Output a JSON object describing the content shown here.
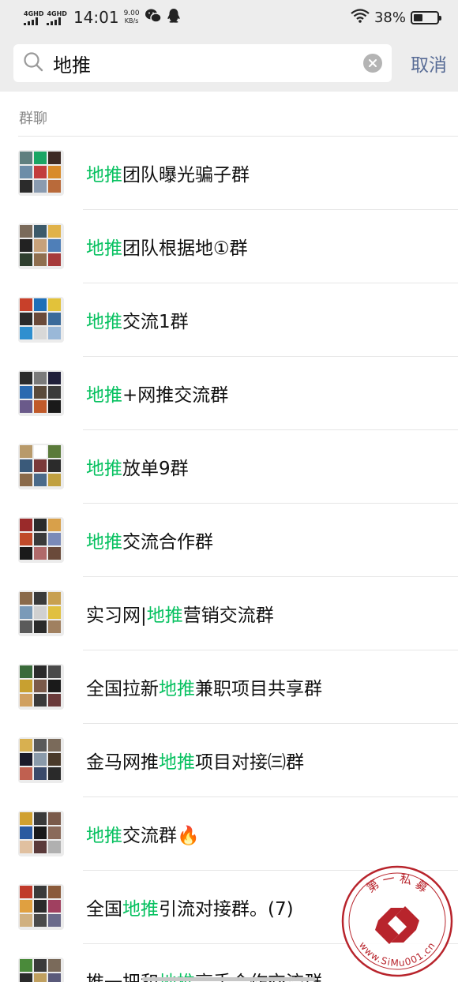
{
  "status_bar": {
    "net1": "4GHD",
    "net2": "4GHD",
    "time": "14:01",
    "speed_value": "9.00",
    "speed_unit": "KB/s",
    "battery_percent": "38%",
    "battery_level": 0.38,
    "icons": [
      "signal-icon",
      "wechat-icon",
      "qq-icon",
      "wifi-icon",
      "battery-icon"
    ]
  },
  "search": {
    "query": "地推",
    "cancel_label": "取消"
  },
  "section": {
    "label": "群聊"
  },
  "results": [
    {
      "before": "",
      "highlight": "地推",
      "after": "团队曝光骗子群",
      "colors": [
        "#5f7f7f",
        "#1aa564",
        "#3d2a24",
        "#6c8da8",
        "#c23d3d",
        "#d88b2a",
        "#2b2b2b",
        "#8a9bb0",
        "#b96a3a"
      ]
    },
    {
      "before": "",
      "highlight": "地推",
      "after": "团队根据地①群",
      "colors": [
        "#7a6a5a",
        "#3c5a6a",
        "#e0b24a",
        "#222222",
        "#c7a17a",
        "#4f7fb8",
        "#2f3f2f",
        "#8f6f4f",
        "#a63a3a"
      ]
    },
    {
      "before": "",
      "highlight": "地推",
      "after": "交流1群",
      "colors": [
        "#c8402a",
        "#1f6fb8",
        "#e2c23a",
        "#2b2b2b",
        "#6a4a3a",
        "#3a6a9a",
        "#2f8fcf",
        "#d8d8d8",
        "#9ab8d8"
      ]
    },
    {
      "before": "",
      "highlight": "地推",
      "after": "+网推交流群",
      "colors": [
        "#2b2b2b",
        "#7a7a7a",
        "#1f1f3a",
        "#2a6ab0",
        "#5a4a3a",
        "#3a3a3a",
        "#6a5a8a",
        "#c05a2a",
        "#1a1a1a"
      ]
    },
    {
      "before": "",
      "highlight": "地推",
      "after": "放单9群",
      "colors": [
        "#b89a6a",
        "#ffffff",
        "#5a7a3a",
        "#3a5a7a",
        "#7a3a3a",
        "#2b2b2b",
        "#8a6a4a",
        "#4a6a8a",
        "#c0a040"
      ]
    },
    {
      "before": "",
      "highlight": "地推",
      "after": "交流合作群",
      "colors": [
        "#9a2a2a",
        "#2b2b2b",
        "#d8a04a",
        "#c04a2a",
        "#3a3a3a",
        "#7a8ab8",
        "#1a1a1a",
        "#b06a6a",
        "#6a4a3a"
      ]
    },
    {
      "before": "实习网|",
      "highlight": "地推",
      "after": "营销交流群",
      "colors": [
        "#8a6a4a",
        "#3a3a3a",
        "#c8a050",
        "#7a9ab8",
        "#d0d0d0",
        "#e0c040",
        "#5a5a5a",
        "#2b2b2b",
        "#a08060"
      ]
    },
    {
      "before": "全国拉新",
      "highlight": "地推",
      "after": "兼职项目共享群",
      "colors": [
        "#3a6a3a",
        "#2b2b2b",
        "#4a4a4a",
        "#c8a030",
        "#7a5a4a",
        "#1a1a1a",
        "#d0a060",
        "#3a3a3a",
        "#6a3a3a"
      ]
    },
    {
      "before": "金马网推",
      "highlight": "地推",
      "after": "项目对接㈢群",
      "colors": [
        "#d8b050",
        "#5a5a5a",
        "#7a6a5a",
        "#1a1a2a",
        "#8a9aaa",
        "#4a3a2a",
        "#c06050",
        "#3a4a6a",
        "#2a2a2a"
      ]
    },
    {
      "before": "",
      "highlight": "地推",
      "after": "交流群🔥",
      "colors": [
        "#d0a030",
        "#3a3a3a",
        "#7a5a4a",
        "#2a5aa0",
        "#1a1a1a",
        "#8a6a5a",
        "#e0c0a0",
        "#5a3a3a",
        "#b0b0b0"
      ]
    },
    {
      "before": "全国",
      "highlight": "地推",
      "after": "引流对接群。(7)",
      "colors": [
        "#c03a2a",
        "#3a3a3a",
        "#8a5a3a",
        "#e0a040",
        "#2b2b2b",
        "#a04060",
        "#d0b080",
        "#4a4a4a",
        "#6a6a8a"
      ]
    },
    {
      "before": "推一把和",
      "highlight": "地推",
      "after": "高手合作交流群",
      "colors": [
        "#4a8a3a",
        "#3a3a3a",
        "#7a6a5a",
        "#2b2b2b",
        "#c0a060",
        "#5a5a7a",
        "#3a3a3a",
        "#8a8a8a",
        "#6a4a3a"
      ]
    }
  ],
  "watermark": {
    "top_text": "第 一 私 募",
    "url_text": "www.SiMu001.cn"
  },
  "colors": {
    "accent_green": "#07c160",
    "cancel_blue": "#576b95",
    "header_bg": "#ededed",
    "watermark_red": "#b8242c"
  }
}
